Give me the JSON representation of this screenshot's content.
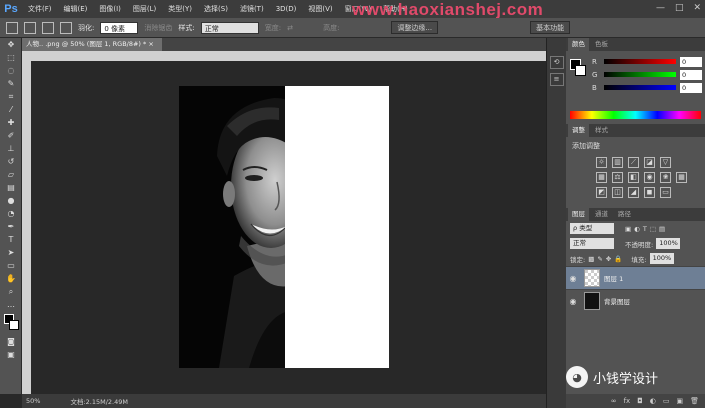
{
  "app": {
    "logo": "Ps"
  },
  "menu": [
    "文件(F)",
    "编辑(E)",
    "图像(I)",
    "图层(L)",
    "类型(Y)",
    "选择(S)",
    "滤镜(T)",
    "3D(D)",
    "视图(V)",
    "窗口(W)",
    "帮助(H)"
  ],
  "watermark": "www.haoxianshej.com",
  "window_controls": [
    "—",
    "□",
    "✕"
  ],
  "options": {
    "feather_label": "羽化:",
    "feather_value": "0 像素",
    "antialias_label": "消除锯齿",
    "style_label": "样式:",
    "style_value": "正常",
    "width_label": "宽度:",
    "height_label": "高度:",
    "refine_edge": "调整边缘...",
    "workspace": "基本功能"
  },
  "document": {
    "tab_title": "人物.. .png @ 50% (图层 1, RGB/8#) *  ×",
    "zoom": "50%",
    "doc_info": "文档:2.15M/2.49M"
  },
  "color_panel": {
    "tabs": [
      "颜色",
      "色板"
    ],
    "channels": [
      {
        "label": "R",
        "value": "0"
      },
      {
        "label": "G",
        "value": "0"
      },
      {
        "label": "B",
        "value": "0"
      }
    ]
  },
  "adjust_panel": {
    "tabs": [
      "调整",
      "样式"
    ],
    "title": "添加调整"
  },
  "layers_panel": {
    "tabs": [
      "图层",
      "通道",
      "路径"
    ],
    "filter": "ρ 类型",
    "blend_mode": "正常",
    "opacity_label": "不透明度:",
    "opacity_value": "100%",
    "lock_label": "锁定:",
    "fill_label": "填充:",
    "fill_value": "100%",
    "layers": [
      {
        "name": "图层 1",
        "selected": true
      },
      {
        "name": "背景图层",
        "selected": false
      }
    ],
    "footer_icons": [
      "∞",
      "fx",
      "◘",
      "◐",
      "▭",
      "▣",
      "🗑"
    ]
  },
  "wechat_caption": "小钱学设计"
}
